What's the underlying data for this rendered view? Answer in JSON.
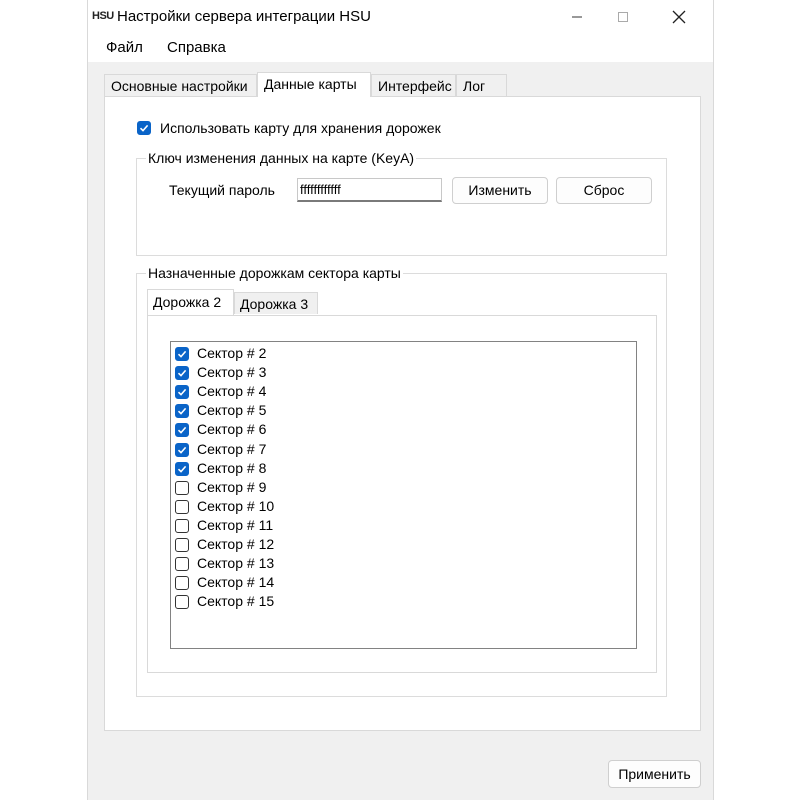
{
  "window": {
    "title": "Настройки сервера интеграции HSU",
    "logo_text": "HSU"
  },
  "menu": {
    "file": "Файл",
    "help": "Справка"
  },
  "tabs": [
    {
      "label": "Основные настройки",
      "active": false
    },
    {
      "label": "Данные карты",
      "active": true
    },
    {
      "label": "Интерфейс",
      "active": false
    },
    {
      "label": "Лог",
      "active": false
    }
  ],
  "card_data": {
    "use_card_label": "Использовать карту для хранения дорожек",
    "use_card_checked": true,
    "key_group": {
      "title": "Ключ изменения данных на карте (KeyA)",
      "password_label": "Текущий пароль",
      "password_value": "ffffffffffff",
      "change_button": "Изменить",
      "reset_button": "Сброс"
    },
    "tracks_group": {
      "title": "Назначенные дорожкам сектора карты",
      "tabs": [
        {
          "label": "Дорожка 2",
          "active": true
        },
        {
          "label": "Дорожка 3",
          "active": false
        }
      ],
      "sectors": [
        {
          "label": "Сектор # 2",
          "checked": true
        },
        {
          "label": "Сектор # 3",
          "checked": true
        },
        {
          "label": "Сектор # 4",
          "checked": true
        },
        {
          "label": "Сектор # 5",
          "checked": true
        },
        {
          "label": "Сектор # 6",
          "checked": true
        },
        {
          "label": "Сектор # 7",
          "checked": true
        },
        {
          "label": "Сектор # 8",
          "checked": true
        },
        {
          "label": "Сектор # 9",
          "checked": false
        },
        {
          "label": "Сектор # 10",
          "checked": false
        },
        {
          "label": "Сектор # 11",
          "checked": false
        },
        {
          "label": "Сектор # 12",
          "checked": false
        },
        {
          "label": "Сектор # 13",
          "checked": false
        },
        {
          "label": "Сектор # 14",
          "checked": false
        },
        {
          "label": "Сектор # 15",
          "checked": false
        }
      ]
    }
  },
  "apply_button": "Применить",
  "colors": {
    "accent": "#0a64c8",
    "window_bg": "#f0f0f0",
    "panel_bg": "#ffffff"
  }
}
